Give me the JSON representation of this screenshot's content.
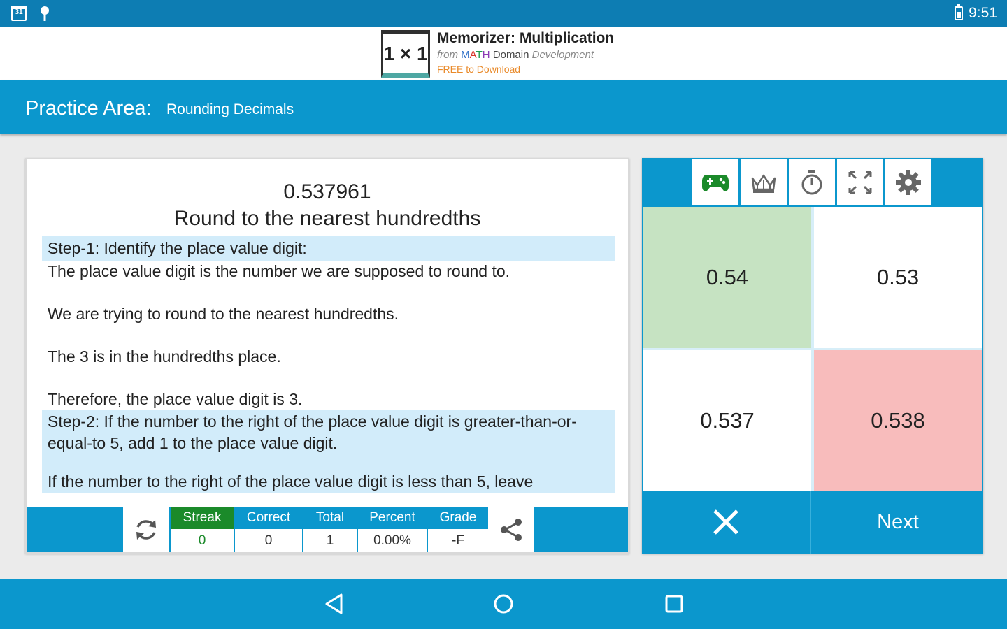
{
  "status_bar": {
    "calendar_day": "31",
    "time": "9:51"
  },
  "ad": {
    "logo_text": "1 × 1",
    "title": "Memorizer: Multiplication",
    "from": "from",
    "brand_m": "M",
    "brand_a": "A",
    "brand_t": "T",
    "brand_h": "H",
    "brand_rest": "Domain",
    "brand_suffix": "Development",
    "cta": "FREE to Download"
  },
  "header": {
    "title": "Practice Area:",
    "subtitle": "Rounding Decimals"
  },
  "problem": {
    "number": "0.537961",
    "instruction": "Round to the nearest hundredths"
  },
  "steps": {
    "step1_title": "Step-1: Identify the place value digit:",
    "step1_p1": "The place value digit is the number we are supposed to round to.",
    "step1_p2": "We are trying to round to the nearest hundredths.",
    "step1_p3": "The 3 is in the hundredths place.",
    "step1_p4": "Therefore, the place value digit is 3.",
    "step2_title": "Step-2: If the number to the right of the place value digit is greater-than-or-equal-to 5, add 1 to the place value digit.",
    "step2_cut": "If the number to the right of the place value digit is less than 5, leave"
  },
  "stats": {
    "streak_label": "Streak",
    "streak_value": "0",
    "correct_label": "Correct",
    "correct_value": "0",
    "total_label": "Total",
    "total_value": "1",
    "percent_label": "Percent",
    "percent_value": "0.00%",
    "grade_label": "Grade",
    "grade_value": "-F"
  },
  "answers": [
    "0.54",
    "0.53",
    "0.537",
    "0.538"
  ],
  "answer_states": {
    "correct_color": "#c6e3c2",
    "wrong_color": "#f8bcbc"
  },
  "actions": {
    "next_label": "Next"
  },
  "colors": {
    "primary": "#0b97cd",
    "status_bar": "#0d7db3",
    "streak_green": "#1b8a2a",
    "highlight": "#d2ecfa"
  }
}
